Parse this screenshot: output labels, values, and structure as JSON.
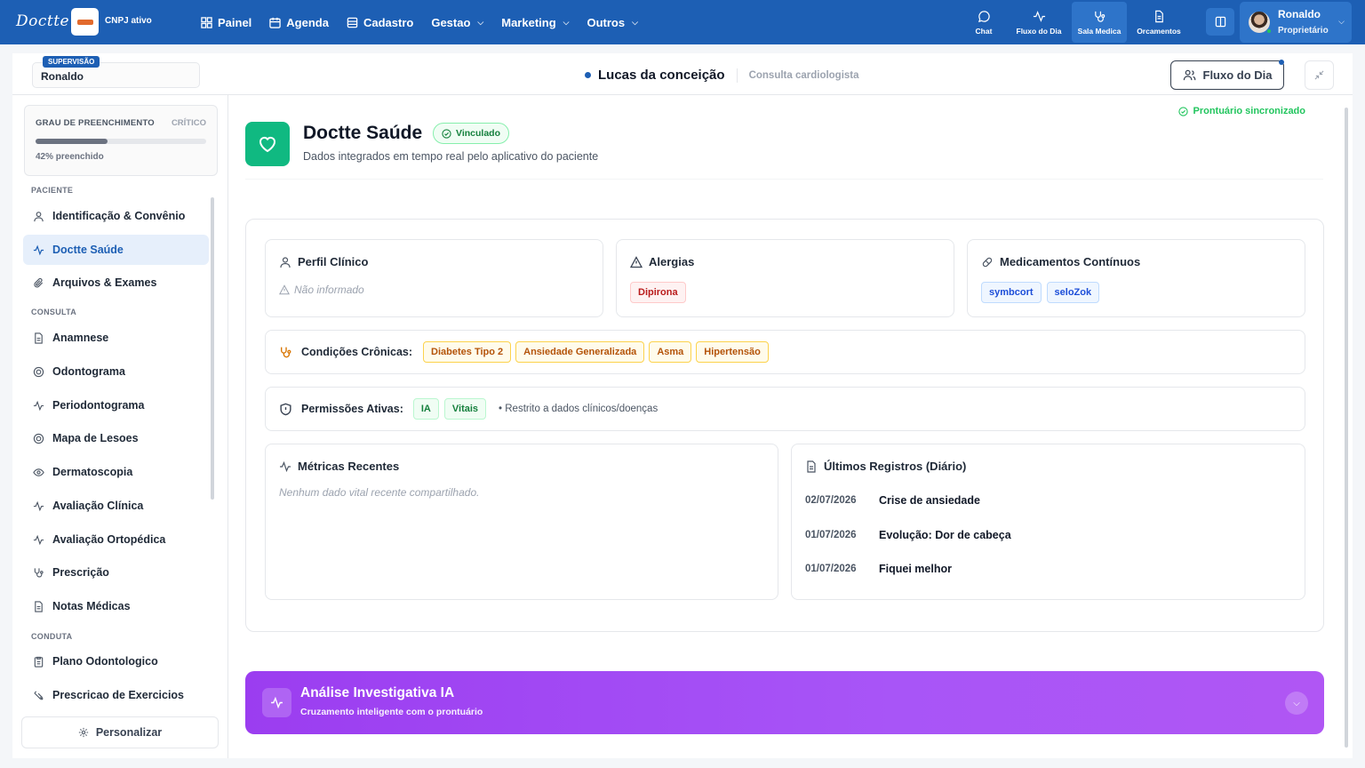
{
  "topbar": {
    "logo": "Doctte",
    "cnpj_label": "CNPJ ativo",
    "nav": [
      {
        "label": "Painel",
        "icon": "grid-icon",
        "dropdown": false
      },
      {
        "label": "Agenda",
        "icon": "calendar-icon",
        "dropdown": false
      },
      {
        "label": "Cadastro",
        "icon": "database-icon",
        "dropdown": false
      },
      {
        "label": "Gestao",
        "icon": "",
        "dropdown": true
      },
      {
        "label": "Marketing",
        "icon": "",
        "dropdown": true
      },
      {
        "label": "Outros",
        "icon": "",
        "dropdown": true
      }
    ],
    "quick": [
      {
        "label": "Chat",
        "icon": "chat-icon"
      },
      {
        "label": "Fluxo do Dia",
        "icon": "activity-icon"
      },
      {
        "label": "Sala Medica",
        "icon": "stethoscope-icon",
        "active": true
      },
      {
        "label": "Orcamentos",
        "icon": "document-icon"
      }
    ],
    "user": {
      "name": "Ronaldo",
      "role": "Proprietário"
    }
  },
  "subheader": {
    "supervisor_badge": "SUPERVISÃO",
    "supervisor_name": "Ronaldo",
    "patient_name": "Lucas da conceição",
    "consult_type": "Consulta cardiologista",
    "flow_button": "Fluxo do Dia"
  },
  "sidebar": {
    "progress": {
      "title": "GRAU DE PREENCHIMENTO",
      "status": "CRÍTICO",
      "percent": 42,
      "text": "42% preenchido"
    },
    "sections": [
      {
        "label": "PACIENTE",
        "items": [
          {
            "label": "Identificação & Convênio",
            "icon": "user-icon"
          },
          {
            "label": "Doctte Saúde",
            "icon": "activity-icon",
            "active": true
          },
          {
            "label": "Arquivos & Exames",
            "icon": "paperclip-icon"
          }
        ]
      },
      {
        "label": "CONSULTA",
        "items": [
          {
            "label": "Anamnese",
            "icon": "document-icon"
          },
          {
            "label": "Odontograma",
            "icon": "target-icon"
          },
          {
            "label": "Periodontograma",
            "icon": "activity-icon"
          },
          {
            "label": "Mapa de Lesoes",
            "icon": "target-icon"
          },
          {
            "label": "Dermatoscopia",
            "icon": "eye-icon"
          },
          {
            "label": "Avaliação Clínica",
            "icon": "activity-icon"
          },
          {
            "label": "Avaliação Ortopédica",
            "icon": "activity-icon"
          },
          {
            "label": "Prescrição",
            "icon": "stethoscope-icon"
          },
          {
            "label": "Notas Médicas",
            "icon": "document-icon"
          }
        ]
      },
      {
        "label": "CONDUTA",
        "items": [
          {
            "label": "Plano Odontologico",
            "icon": "clipboard-icon"
          },
          {
            "label": "Prescricao de Exercicios",
            "icon": "dumbbell-icon"
          }
        ]
      }
    ],
    "personalize": "Personalizar"
  },
  "main": {
    "sync_status": "Prontuário sincronizado",
    "title": "Doctte Saúde",
    "linked_badge": "Vinculado",
    "subtitle": "Dados integrados em tempo real pelo aplicativo do paciente",
    "profile": {
      "title": "Perfil Clínico",
      "empty": "Não informado"
    },
    "allergies": {
      "title": "Alergias",
      "items": [
        "Dipirona"
      ]
    },
    "medications": {
      "title": "Medicamentos Contínuos",
      "items": [
        "symbcort",
        "seloZok"
      ]
    },
    "chronic": {
      "label": "Condições Crônicas:",
      "items": [
        "Diabetes Tipo 2",
        "Ansiedade Generalizada",
        "Asma",
        "Hipertensão"
      ]
    },
    "permissions": {
      "label": "Permissões Ativas:",
      "items": [
        "IA",
        "Vitais"
      ],
      "note": "• Restrito a dados clínicos/doenças"
    },
    "metrics": {
      "title": "Métricas Recentes",
      "empty": "Nenhum dado vital recente compartilhado."
    },
    "records": {
      "title": "Últimos Registros (Diário)",
      "items": [
        {
          "date": "02/07/2026",
          "text": "Crise de ansiedade"
        },
        {
          "date": "01/07/2026",
          "text": "Evolução: Dor de cabeça"
        },
        {
          "date": "01/07/2026",
          "text": "Fiquei melhor"
        }
      ]
    },
    "ia": {
      "title": "Análise Investigativa IA",
      "subtitle": "Cruzamento inteligente com o prontuário"
    }
  },
  "colors": {
    "primary": "#1d5fb4",
    "success": "#10b981",
    "ia": "#a855f7"
  }
}
